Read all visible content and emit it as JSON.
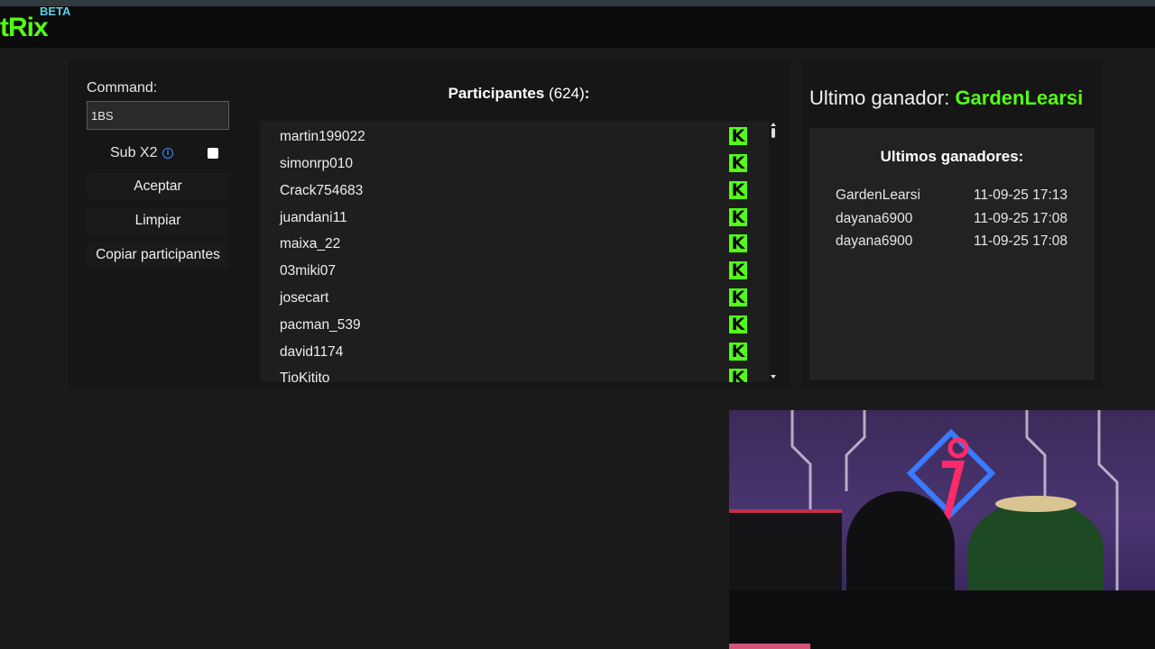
{
  "app": {
    "logo_text": "tRix",
    "badge": "BETA"
  },
  "controls": {
    "command_label": "Command:",
    "command_value": "1BS",
    "sub_label": "Sub X2",
    "info_icon": "ⓘ",
    "sub_checked": false,
    "accept_label": "Aceptar",
    "clear_label": "Limpiar",
    "copy_label": "Copiar participantes"
  },
  "participants": {
    "title": "Participantes",
    "count": "(624)",
    "suffix": ":",
    "platform_icon": "K",
    "list": [
      "martin199022",
      "simonrp010",
      "Crack754683",
      "juandani11",
      "maixa_22",
      "03miki07",
      "josecart",
      "pacman_539",
      "david1174",
      "TioKitito"
    ]
  },
  "winner": {
    "label": "Ultimo ganador:",
    "name": "GardenLearsi"
  },
  "recent_winners": {
    "title": "Ultimos ganadores:",
    "items": [
      {
        "name": "GardenLearsi",
        "time": "11-09-25 17:13"
      },
      {
        "name": "dayana6900",
        "time": "11-09-25 17:08"
      },
      {
        "name": "dayana6900",
        "time": "11-09-25 17:08"
      }
    ]
  },
  "colors": {
    "accent_green": "#53fc18",
    "badge_blue": "#5ad1e8",
    "info_blue": "#3d8bff"
  },
  "icons": {
    "kick": "kick-icon",
    "info": "info-icon"
  }
}
